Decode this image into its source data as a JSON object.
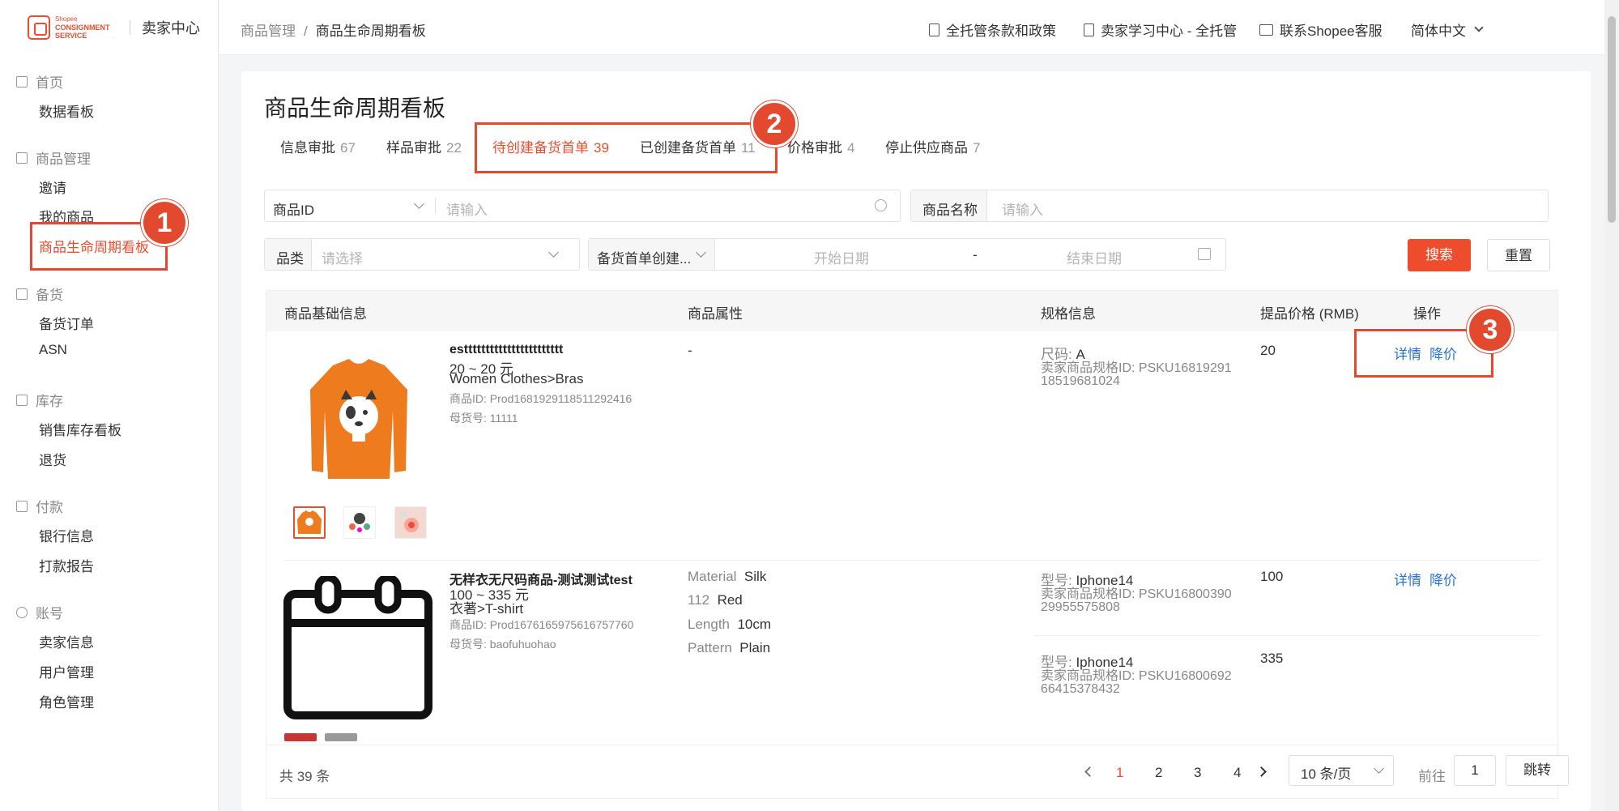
{
  "logo": {
    "brand": "Shopee",
    "line1": "CONSIGNMENT",
    "line2": "SERVICE",
    "title": "卖家中心"
  },
  "sidebar": {
    "groups": [
      {
        "head": "首页",
        "items": [
          "数据看板"
        ]
      },
      {
        "head": "商品管理",
        "items": [
          "邀请",
          "我的商品",
          "商品生命周期看板"
        ]
      },
      {
        "head": "备货",
        "items": [
          "备货订单",
          "ASN"
        ]
      },
      {
        "head": "库存",
        "items": [
          "销售库存看板",
          "退货"
        ]
      },
      {
        "head": "付款",
        "items": [
          "银行信息",
          "打款报告"
        ]
      },
      {
        "head": "账号",
        "items": [
          "卖家信息",
          "用户管理",
          "角色管理"
        ]
      }
    ]
  },
  "breadcrumb": {
    "parent": "商品管理",
    "sep": "/",
    "current": "商品生命周期看板"
  },
  "topbar": {
    "link1": "全托管条款和政策",
    "link2": "卖家学习中心 - 全托管",
    "link3": "联系Shopee客服",
    "lang": "简体中文"
  },
  "page": {
    "title": "商品生命周期看板"
  },
  "tabs": [
    {
      "label": "信息审批",
      "count": "67"
    },
    {
      "label": "样品审批",
      "count": "22"
    },
    {
      "label": "待创建备货首单",
      "count": "39"
    },
    {
      "label": "已创建备货首单",
      "count": "11"
    },
    {
      "label": "价格审批",
      "count": "4"
    },
    {
      "label": "停止供应商品",
      "count": "7"
    }
  ],
  "filters": {
    "id_type": "商品ID",
    "id_placeholder": "请输入",
    "name_label": "商品名称",
    "name_placeholder": "请输入",
    "category_label": "品类",
    "category_placeholder": "请选择",
    "date_type": "备货首单创建...",
    "start_placeholder": "开始日期",
    "date_sep": "-",
    "end_placeholder": "结束日期",
    "search": "搜索",
    "reset": "重置"
  },
  "table": {
    "headers": [
      "商品基础信息",
      "商品属性",
      "规格信息",
      "提品价格 (RMB)",
      "操作"
    ],
    "rows": [
      {
        "title": "esttttttttttttttttttttttt",
        "price_range": "20 ~ 20 元",
        "category": "Women Clothes>Bras",
        "product_id": "商品ID: Prod1681929118511292416",
        "parent_sku": "母货号: 11111",
        "attributes": "-",
        "specs": [
          {
            "name": "尺码: ",
            "value": "A",
            "sku1": "卖家商品规格ID: PSKU16819291",
            "sku2": "18519681024",
            "price": "20"
          }
        ],
        "actions": {
          "detail": "详情",
          "reduce": "降价"
        }
      },
      {
        "title": "无样衣无尺码商品-测试测试test",
        "price_range": "100 ~ 335 元",
        "category": "衣著>T-shirt",
        "product_id": "商品ID: Prod1676165975616757760",
        "parent_sku": "母货号: baofuhuohao",
        "attributes": [
          {
            "k": "Material",
            "v": "Silk"
          },
          {
            "k": "112",
            "v": "Red"
          },
          {
            "k": "Length",
            "v": "10cm"
          },
          {
            "k": "Pattern",
            "v": "Plain"
          }
        ],
        "specs": [
          {
            "name": "型号: ",
            "value": "Iphone14",
            "sku1": "卖家商品规格ID: PSKU16800390",
            "sku2": "29955575808",
            "price": "100"
          },
          {
            "name": "型号: ",
            "value": "Iphone14",
            "sku1": "卖家商品规格ID: PSKU16800692",
            "sku2": "66415378432",
            "price": "335"
          }
        ],
        "actions": {
          "detail": "详情",
          "reduce": "降价"
        }
      }
    ]
  },
  "pagination": {
    "total": "共 39 条",
    "pages": [
      "1",
      "2",
      "3",
      "4"
    ],
    "page_size": "10 条/页",
    "goto_label": "前往",
    "goto_value": "1",
    "jump": "跳转"
  },
  "annotations": [
    "1",
    "2",
    "3"
  ],
  "colors": {
    "accent": "#ee4d2d",
    "link": "#2673dd",
    "annotation": "#e2492f"
  }
}
